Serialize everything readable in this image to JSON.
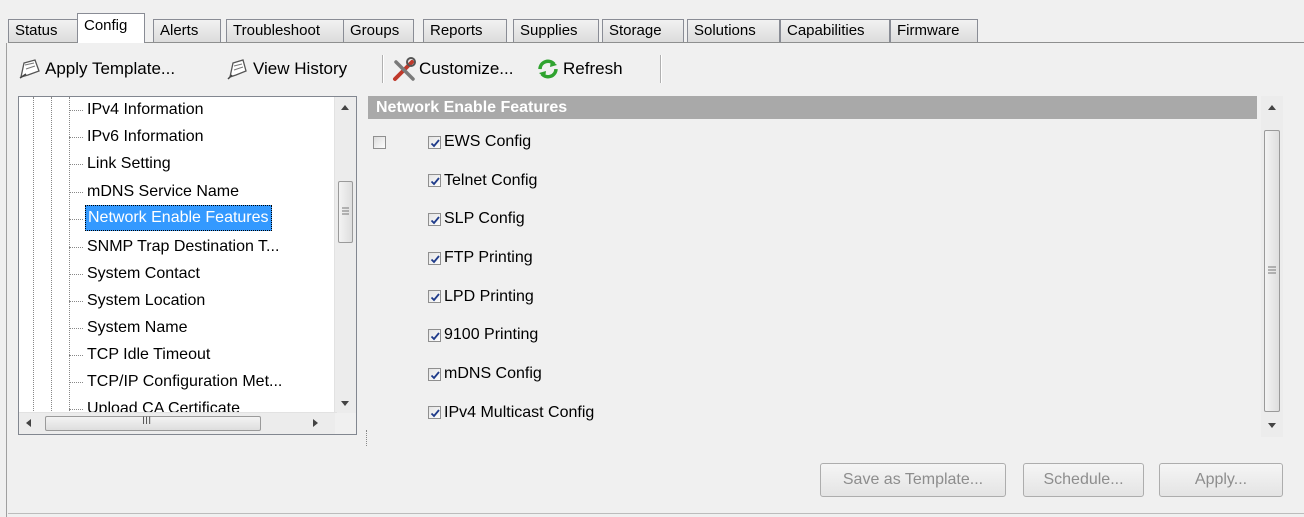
{
  "tabs": [
    {
      "label": "Status"
    },
    {
      "label": "Config"
    },
    {
      "label": "Alerts"
    },
    {
      "label": "Troubleshoot"
    },
    {
      "label": "Groups"
    },
    {
      "label": "Reports"
    },
    {
      "label": "Supplies"
    },
    {
      "label": "Storage"
    },
    {
      "label": "Solutions"
    },
    {
      "label": "Capabilities"
    },
    {
      "label": "Firmware"
    }
  ],
  "active_tab": "Config",
  "toolbar": {
    "apply_template": "Apply Template...",
    "view_history": "View History",
    "customize": "Customize...",
    "refresh": "Refresh"
  },
  "tree": {
    "items": [
      {
        "label": "IPv4 Information"
      },
      {
        "label": "IPv6 Information"
      },
      {
        "label": "Link Setting"
      },
      {
        "label": "mDNS Service Name"
      },
      {
        "label": "Network Enable Features"
      },
      {
        "label": "SNMP Trap Destination T..."
      },
      {
        "label": "System Contact"
      },
      {
        "label": "System Location"
      },
      {
        "label": "System Name"
      },
      {
        "label": "TCP Idle Timeout"
      },
      {
        "label": "TCP/IP Configuration Met..."
      },
      {
        "label": "Upload CA Certificate"
      }
    ],
    "selected": "Network Enable Features",
    "hscroll_grip": "III"
  },
  "features": {
    "header": "Network Enable Features",
    "master_checked": false,
    "items": [
      {
        "label": "EWS Config",
        "checked": true
      },
      {
        "label": "Telnet Config",
        "checked": true
      },
      {
        "label": "SLP Config",
        "checked": true
      },
      {
        "label": "FTP Printing",
        "checked": true
      },
      {
        "label": "LPD Printing",
        "checked": true
      },
      {
        "label": "9100 Printing",
        "checked": true
      },
      {
        "label": "mDNS Config",
        "checked": true
      },
      {
        "label": "IPv4 Multicast Config",
        "checked": true
      }
    ]
  },
  "buttons": {
    "save_template": "Save as Template...",
    "schedule": "Schedule...",
    "apply": "Apply..."
  },
  "colors": {
    "selection": "#3399ff",
    "header_bg": "#a9a9a9",
    "refresh_green": "#2fa32f",
    "customize_red": "#c0392b"
  }
}
